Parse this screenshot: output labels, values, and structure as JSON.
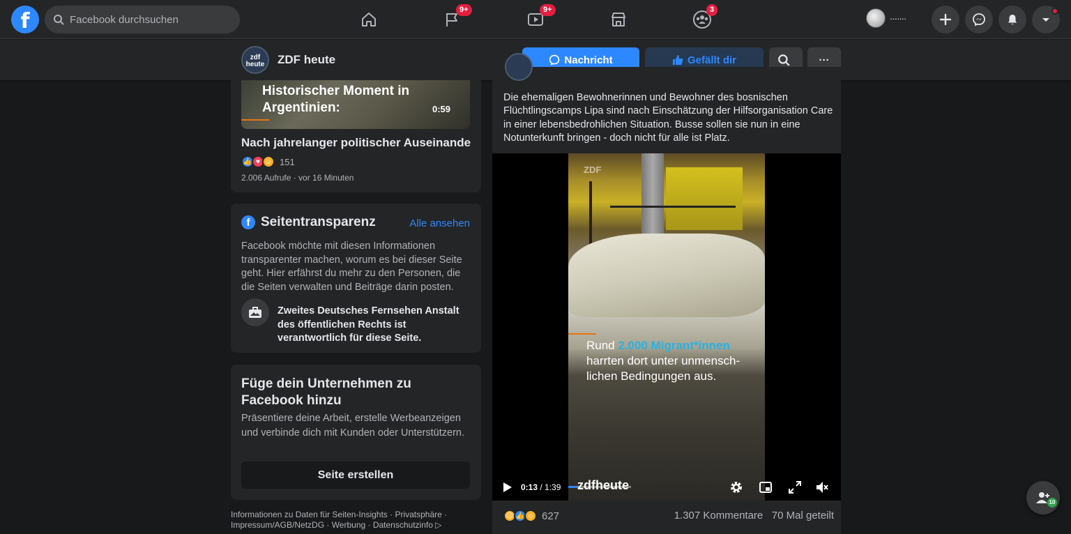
{
  "topbar": {
    "search_placeholder": "Facebook durchsuchen",
    "badges": {
      "pages": "9+",
      "watch": "9+",
      "groups": "3"
    },
    "profile_name": "·······"
  },
  "page_header": {
    "page_name": "ZDF heute",
    "avatar_text": "zdf heute",
    "message_button": "Nachricht",
    "liked_button": "Gefällt dir",
    "more_button": "···"
  },
  "video_card": {
    "thumbnail_title": "Historischer Moment in Argentinien:",
    "duration": "0:59",
    "title": "Nach jahrelanger politischer Auseinande...",
    "reaction_count": "151",
    "meta": "2.006 Aufrufe · vor 16 Minuten"
  },
  "transparency": {
    "title": "Seitentransparenz",
    "see_all": "Alle ansehen",
    "description": "Facebook möchte mit diesen Informationen transparenter machen, worum es bei dieser Seite geht. Hier erfährst du mehr zu den Personen, die die Seiten verwalten und Beiträge darin posten.",
    "organization": "Zweites Deutsches Fernsehen Anstalt des öffentlichen Rechts ist verantwortlich für diese Seite."
  },
  "create_page": {
    "title": "Füge dein Unternehmen zu Facebook hinzu",
    "description": "Präsentiere deine Arbeit, erstelle Werbeanzeigen und verbinde dich mit Kunden oder Unterstützern.",
    "button": "Seite erstellen"
  },
  "footer": {
    "links": "Informationen zu Daten für Seiten-Insights · Privatsphäre · Impressum/AGB/NetzDG · Werbung · Datenschutzinfo ▷"
  },
  "post": {
    "text": "Die ehemaligen Bewohnerinnen und Bewohner des bosnischen Flüchtlingscamps Lipa sind nach Einschätzung der Hilfsorganisation Care in einer lebensbedrohlichen Situation. Busse sollen sie nun in eine Notunterkunft bringen - doch nicht für alle ist Platz.",
    "video": {
      "watermark": "ZDF",
      "caption_before": "Rund ",
      "caption_highlight": "2.000 Migrant*innen",
      "caption_after": " harrten dort unter unmensch-lichen Bedingungen aus.",
      "time_current": "0:13",
      "time_total": "/ 1:39",
      "progress": 0.13,
      "brand": "zdfheute"
    },
    "reaction_count": "627",
    "comments": "1.307 Kommentare",
    "shares": "70 Mal geteilt"
  },
  "contacts_badge": "10",
  "colors": {
    "accent": "#2d88ff",
    "badge": "#e41e3f",
    "background": "#18191a",
    "surface": "#242526",
    "highlight": "#29b2e4"
  }
}
